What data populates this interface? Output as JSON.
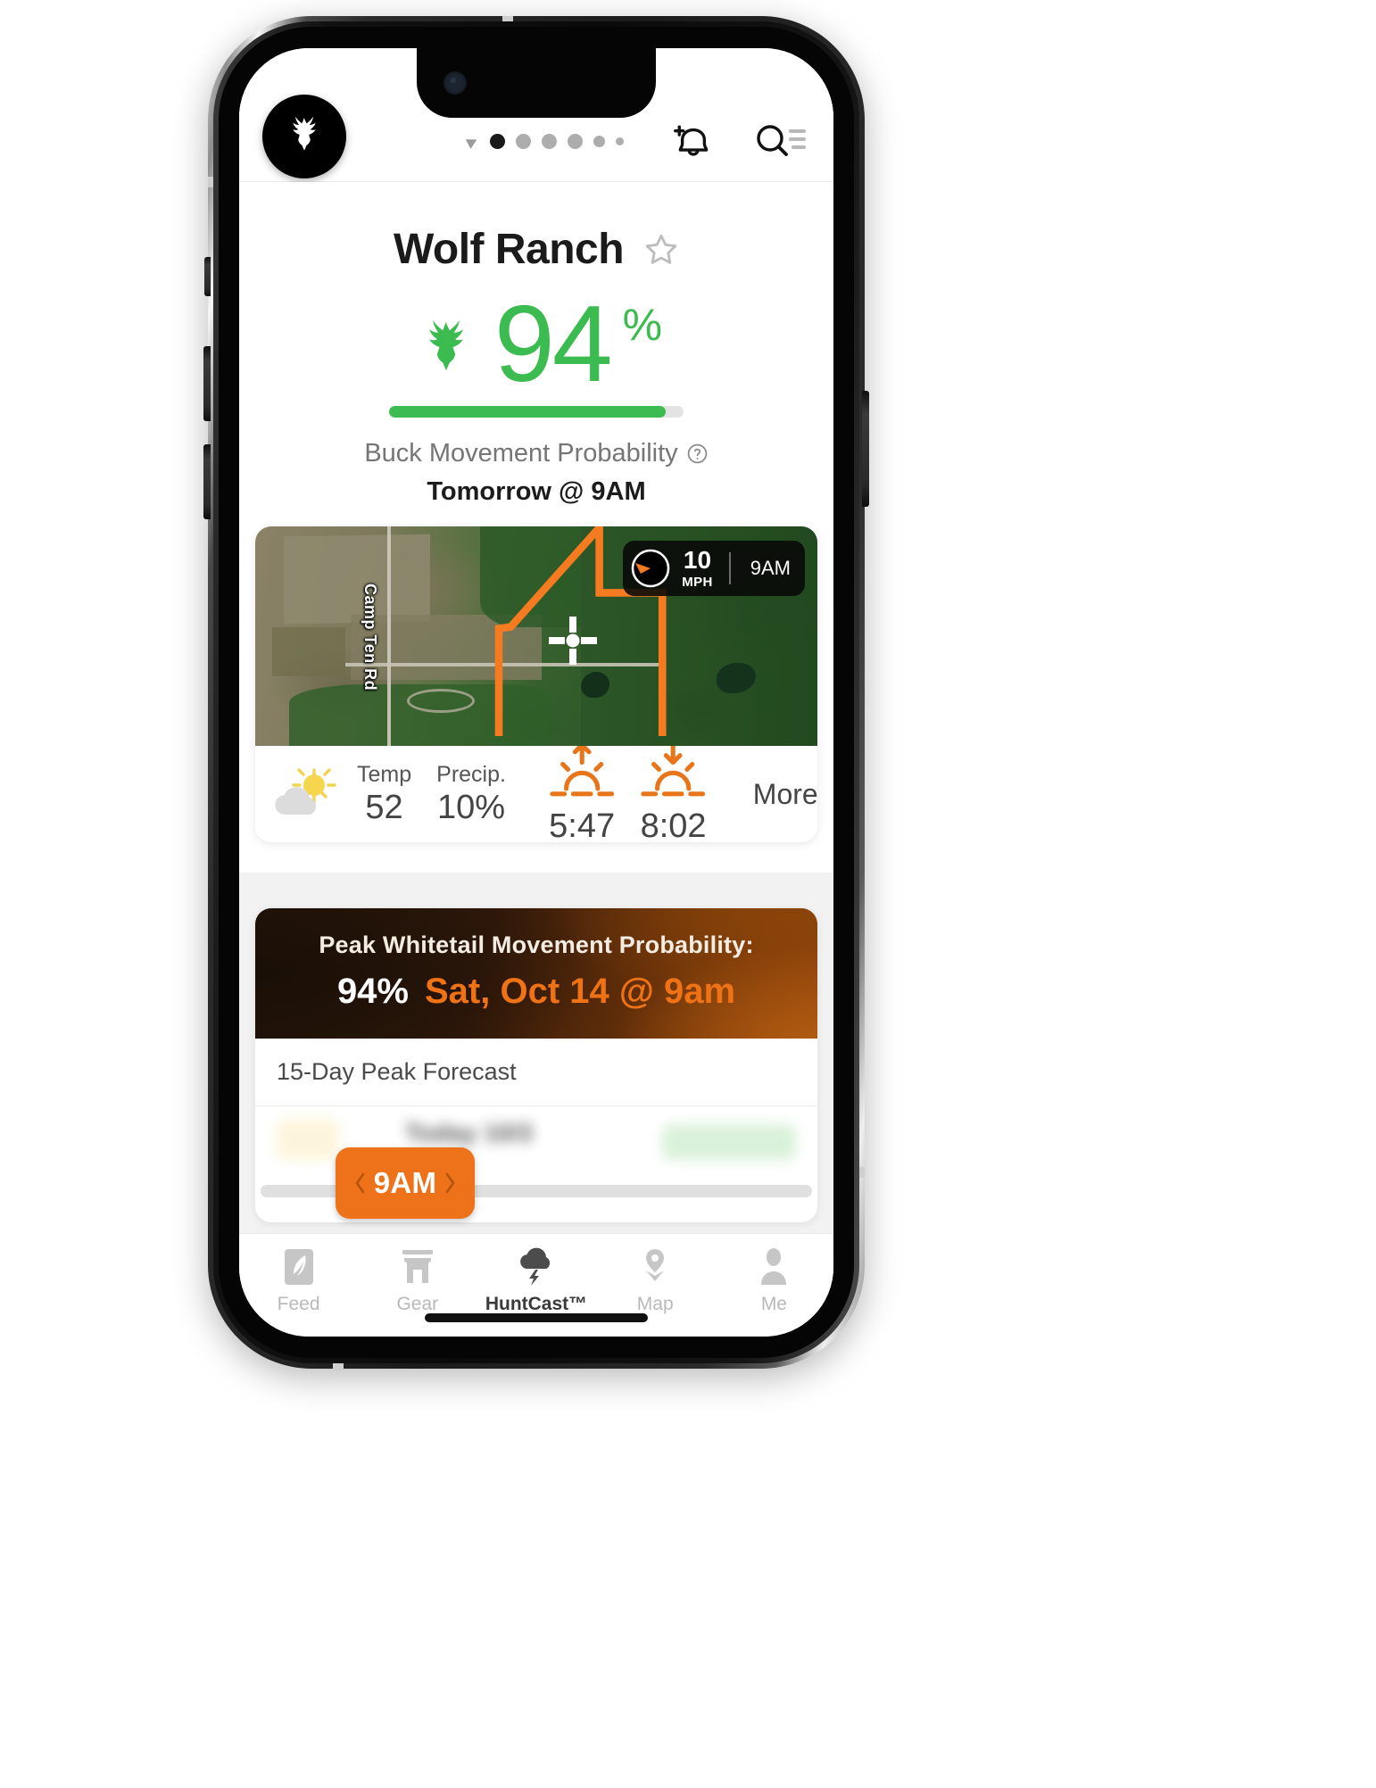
{
  "brand": {
    "accent_orange": "#ee7219",
    "accent_green": "#3cbb50",
    "logo_icon": "deer-head-icon"
  },
  "header": {
    "logo_icon": "deer-head-logo-icon",
    "location_arrow_icon": "location-arrow-icon",
    "pagination_dots": 6,
    "active_dot_index": 0,
    "notifications_icon": "bell-plus-icon",
    "search_icon": "search-list-icon"
  },
  "location": {
    "name": "Wolf Ranch",
    "favorite_icon": "star-outline-icon",
    "favorited": false
  },
  "probability": {
    "deer_icon": "deer-head-icon",
    "value": "94",
    "percent_symbol": "%",
    "bar_percent": 94,
    "label": "Buck Movement Probability",
    "help_icon": "question-circle-icon",
    "when": "Tomorrow @ 9AM"
  },
  "map": {
    "road_label": "Camp Ten Rd",
    "marker_icon": "crosshair-marker-icon",
    "boundary_color": "#f47b20",
    "wind": {
      "compass_icon": "wind-compass-icon",
      "speed": "10",
      "unit": "MPH",
      "time": "9AM"
    }
  },
  "weather": {
    "condition_icon": "partly-cloudy-icon",
    "items": [
      {
        "label": "Temp",
        "value": "52"
      },
      {
        "label": "Precip.",
        "value": "10%"
      }
    ],
    "sunrise": {
      "icon": "sunrise-icon",
      "value": "5:47"
    },
    "sunset": {
      "icon": "sunset-icon",
      "value": "8:02"
    },
    "more_label": "More"
  },
  "peak_banner": {
    "title": "Peak Whitetail Movement Probability:",
    "percent": "94%",
    "datetime": "Sat, Oct 14 @ 9am"
  },
  "forecast": {
    "header": "15-Day Peak Forecast",
    "first_row_day": "Today 10/3"
  },
  "time_slider": {
    "prev_icon": "chevron-left-icon",
    "value": "9AM",
    "next_icon": "chevron-right-icon"
  },
  "tabbar": {
    "items": [
      {
        "label": "Feed",
        "icon": "feed-icon",
        "active": false
      },
      {
        "label": "Gear",
        "icon": "store-icon",
        "active": false
      },
      {
        "label": "HuntCast™",
        "icon": "storm-cloud-icon",
        "active": true
      },
      {
        "label": "Map",
        "icon": "map-pin-icon",
        "active": false
      },
      {
        "label": "Me",
        "icon": "person-icon",
        "active": false
      }
    ]
  }
}
